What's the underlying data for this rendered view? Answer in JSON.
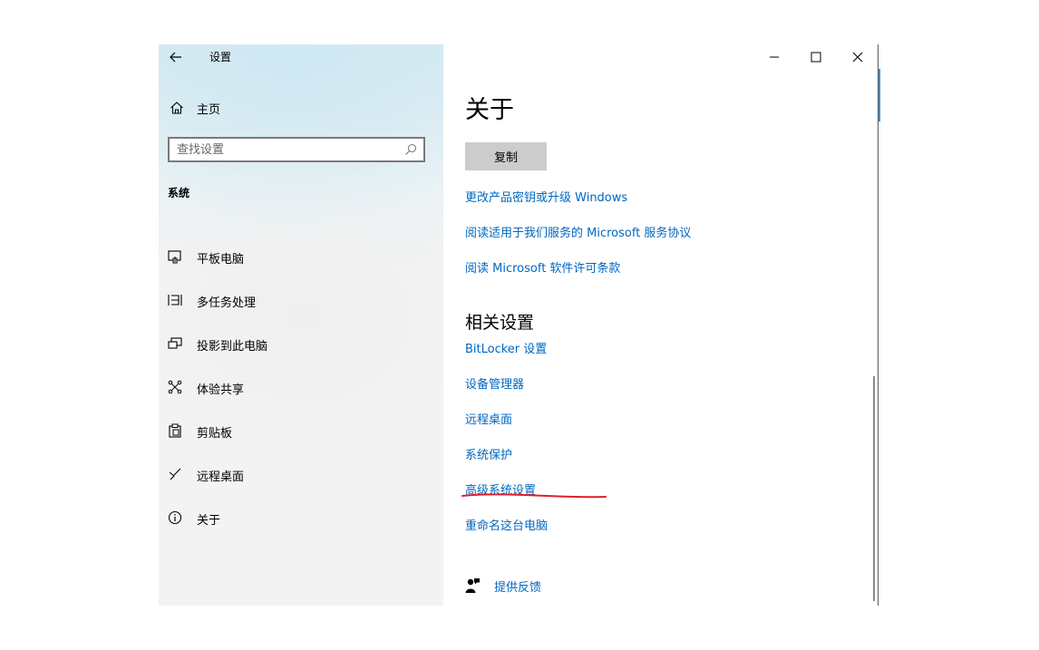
{
  "window": {
    "title": "设置"
  },
  "sidebar": {
    "home_label": "主页",
    "search_placeholder": "查找设置",
    "section_title": "系统",
    "items": [
      {
        "label": "平板电脑",
        "icon": "tablet-icon"
      },
      {
        "label": "多任务处理",
        "icon": "multitasking-icon"
      },
      {
        "label": "投影到此电脑",
        "icon": "project-icon"
      },
      {
        "label": "体验共享",
        "icon": "share-icon"
      },
      {
        "label": "剪贴板",
        "icon": "clipboard-icon"
      },
      {
        "label": "远程桌面",
        "icon": "remote-desktop-icon"
      },
      {
        "label": "关于",
        "icon": "info-icon"
      }
    ]
  },
  "main": {
    "title": "关于",
    "copy_button": "复制",
    "links": [
      "更改产品密钥或升级 Windows",
      "阅读适用于我们服务的 Microsoft 服务协议",
      "阅读 Microsoft 软件许可条款"
    ],
    "related_title": "相关设置",
    "related_links": [
      "BitLocker 设置",
      "设备管理器",
      "远程桌面",
      "系统保护",
      "高级系统设置",
      "重命名这台电脑"
    ],
    "feedback_label": "提供反馈"
  },
  "colors": {
    "link": "#0067c0",
    "annotation": "#e0202a",
    "button_bg": "#cccccc"
  }
}
